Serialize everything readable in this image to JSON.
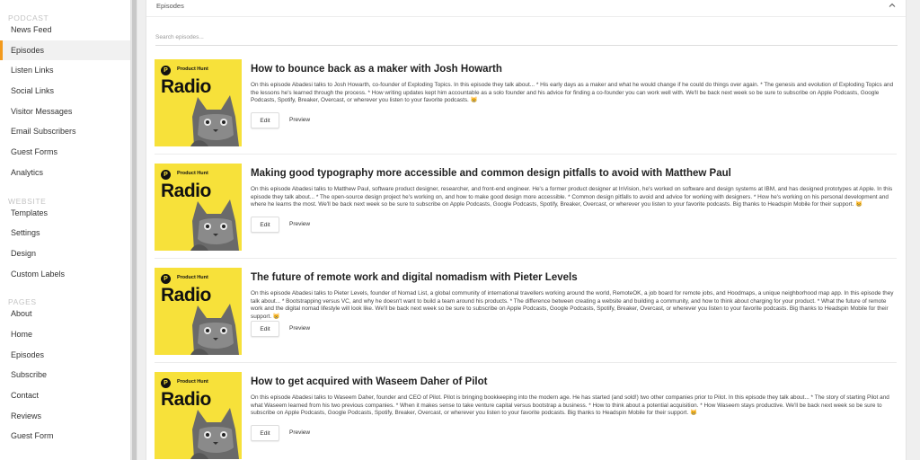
{
  "sidebar": {
    "sections": [
      {
        "heading": "PODCAST",
        "items": [
          "News Feed",
          "Episodes",
          "Listen Links",
          "Social Links",
          "Visitor Messages",
          "Email Subscribers",
          "Guest Forms",
          "Analytics"
        ]
      },
      {
        "heading": "WEBSITE",
        "items": [
          "Templates",
          "Settings",
          "Design",
          "Custom Labels"
        ]
      },
      {
        "heading": "PAGES",
        "items": [
          "About",
          "Home",
          "Episodes",
          "Subscribe",
          "Contact",
          "Reviews",
          "Guest Form"
        ]
      }
    ],
    "active": "Episodes",
    "accent_color": "#f39a1d"
  },
  "panel": {
    "title": "Episodes",
    "collapse_icon": "chevron-up-icon",
    "search_placeholder": "Search episodes..."
  },
  "thumbnail": {
    "brand": "Product Hunt",
    "name": "Radio",
    "logo_letter": "P",
    "background": "#f7e13a"
  },
  "episodes": [
    {
      "title": "How to bounce back as a maker with Josh Howarth",
      "description": "On this episode Abadesi talks to Josh Howarth, co-founder of Exploding Topics. In this episode they talk about... * His early days as a maker and what he would change if he could do things over again. * The genesis and evolution of Exploding Topics and the lessons he's learned through the process. * How writing updates kept him accountable as a solo founder and his advice for finding a co-founder you can work well with. We'll be back next week so be sure to subscribe on Apple Podcasts, Google Podcasts, Spotify, Breaker, Overcast, or wherever you listen to your favorite podcasts. 😸",
      "edit_label": "Edit",
      "preview_label": "Preview"
    },
    {
      "title": "Making good typography more accessible and common design pitfalls to avoid with Matthew Paul",
      "description": "On this episode Abadesi talks to Matthew Paul, software product designer, researcher, and front-end engineer. He's a former product designer at InVision, he's worked on software and design systems at IBM, and has designed prototypes at Apple. In this episode they talk about... * The open-source design project he's working on, and how to make good design more accessible. * Common design pitfalls to avoid and advice for working with designers. * How he's working on his personal development and where he learns the most. We'll be back next week so be sure to subscribe on Apple Podcasts, Google Podcasts, Spotify, Breaker, Overcast, or wherever you listen to your favorite podcasts. Big thanks to Headspin Mobile for their support. 😸",
      "edit_label": "Edit",
      "preview_label": "Preview"
    },
    {
      "title": "The future of remote work and digital nomadism with Pieter Levels",
      "description": "On this episode Abadesi talks to Pieter Levels, founder of Nomad List, a global community of international travellers working around the world, RemoteOK, a job board for remote jobs, and Hoodmaps, a unique neighborhood map app. In this episode they talk about... * Bootstrapping versus VC, and why he doesn't want to build a team around his products. * The difference between creating a website and building a community, and how to think about charging for your product. * What the future of remote work and the digital nomad lifestyle will look like. We'll be back next week so be sure to subscribe on Apple Podcasts, Google Podcasts, Spotify, Breaker, Overcast, or wherever you listen to your favorite podcasts. Big thanks to Headspin Mobile for their support. 😸",
      "edit_label": "Edit",
      "preview_label": "Preview"
    },
    {
      "title": "How to get acquired with Waseem Daher of Pilot",
      "description": "On this episode Abadesi talks to Waseem Daher, founder and CEO of Pilot. Pilot is bringing bookkeeping into the modern age. He has started (and sold!) two other companies prior to Pilot. In this episode they talk about... * The story of starting Pilot and what Waseem learned from his two previous companies. * When it makes sense to take venture capital versus bootstrap a business. * How to think about a potential acquisition. * How Waseem stays productive. We'll be back next week so be sure to subscribe on Apple Podcasts, Google Podcasts, Spotify, Breaker, Overcast, or wherever you listen to your favorite podcasts. Big thanks to Headspin Mobile for their support. 😸",
      "edit_label": "Edit",
      "preview_label": "Preview"
    }
  ]
}
